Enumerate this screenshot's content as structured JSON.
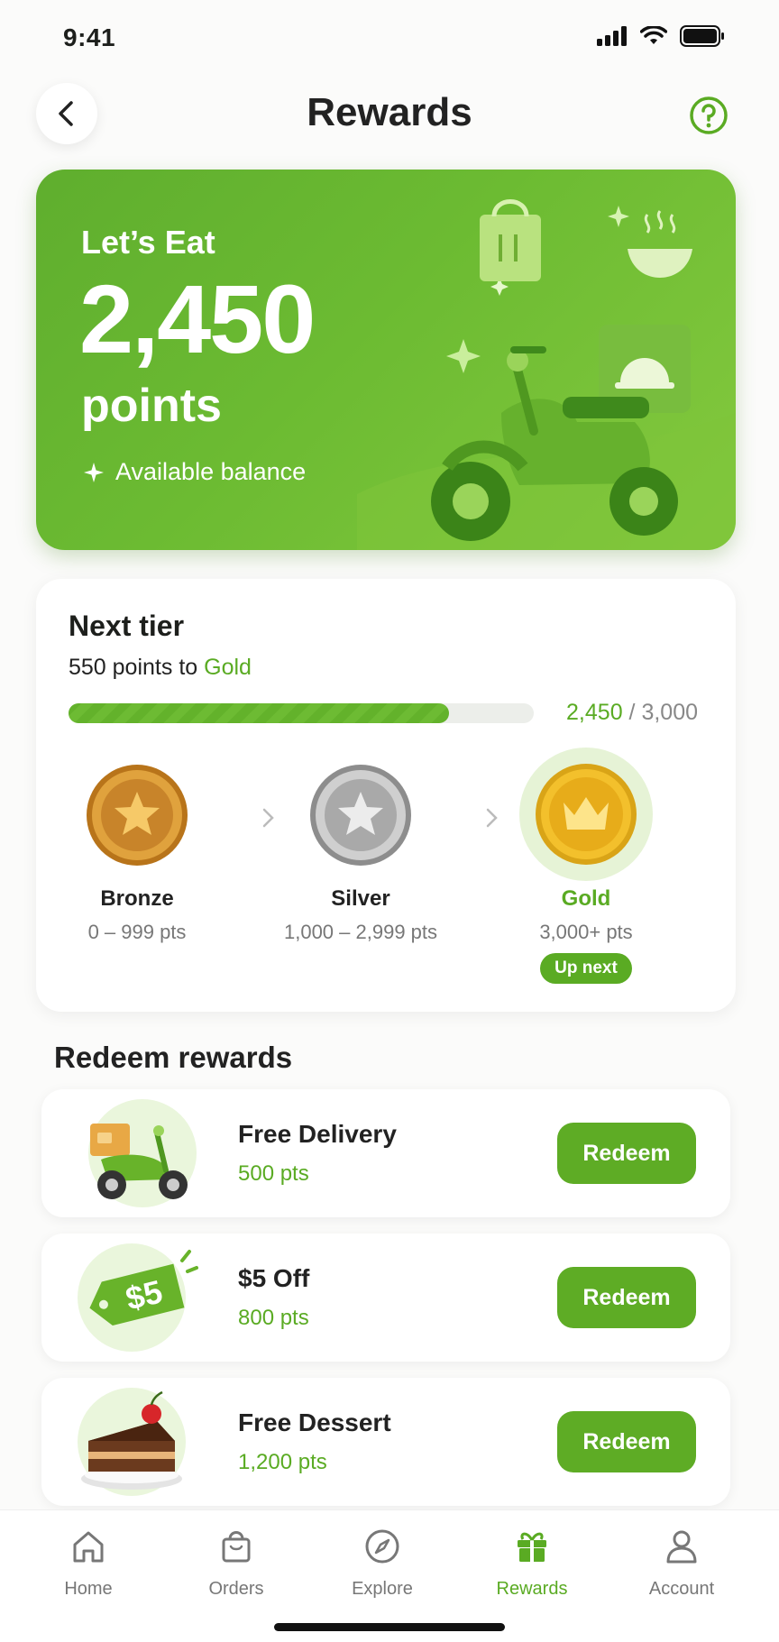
{
  "status_bar": {
    "time": "9:41"
  },
  "header": {
    "title": "Rewards"
  },
  "hero": {
    "brand": "Let’s Eat",
    "points": "2,450",
    "points_label": "points",
    "balance_label": "Available balance"
  },
  "next_tier": {
    "title": "Next tier",
    "subtitle_prefix": "550 points to ",
    "subtitle_tier": "Gold",
    "progress_current": "2,450",
    "progress_separator": " / ",
    "progress_target": "3,000",
    "progress_fraction": 0.817,
    "tiers": [
      {
        "name": "Bronze",
        "range": "0 – 999 pts"
      },
      {
        "name": "Silver",
        "range": "1,000 – 2,999 pts"
      },
      {
        "name": "Gold",
        "range": "3,000+ pts",
        "badge": "Up next"
      }
    ]
  },
  "redeem": {
    "title": "Redeem rewards",
    "items": [
      {
        "name": "Free Delivery",
        "points": "500 pts",
        "button": "Redeem",
        "icon": "scooter-icon"
      },
      {
        "name": "$5 Off",
        "points": "800 pts",
        "button": "Redeem",
        "icon": "price-tag-icon",
        "tag_text": "$5"
      },
      {
        "name": "Free Dessert",
        "points": "1,200 pts",
        "button": "Redeem",
        "icon": "cake-icon"
      }
    ]
  },
  "tabbar": {
    "items": [
      {
        "label": "Home"
      },
      {
        "label": "Orders"
      },
      {
        "label": "Explore"
      },
      {
        "label": "Rewards",
        "active": true
      },
      {
        "label": "Account"
      }
    ]
  },
  "colors": {
    "accent": "#5aab23",
    "hero_bg": "#6cbb32"
  }
}
